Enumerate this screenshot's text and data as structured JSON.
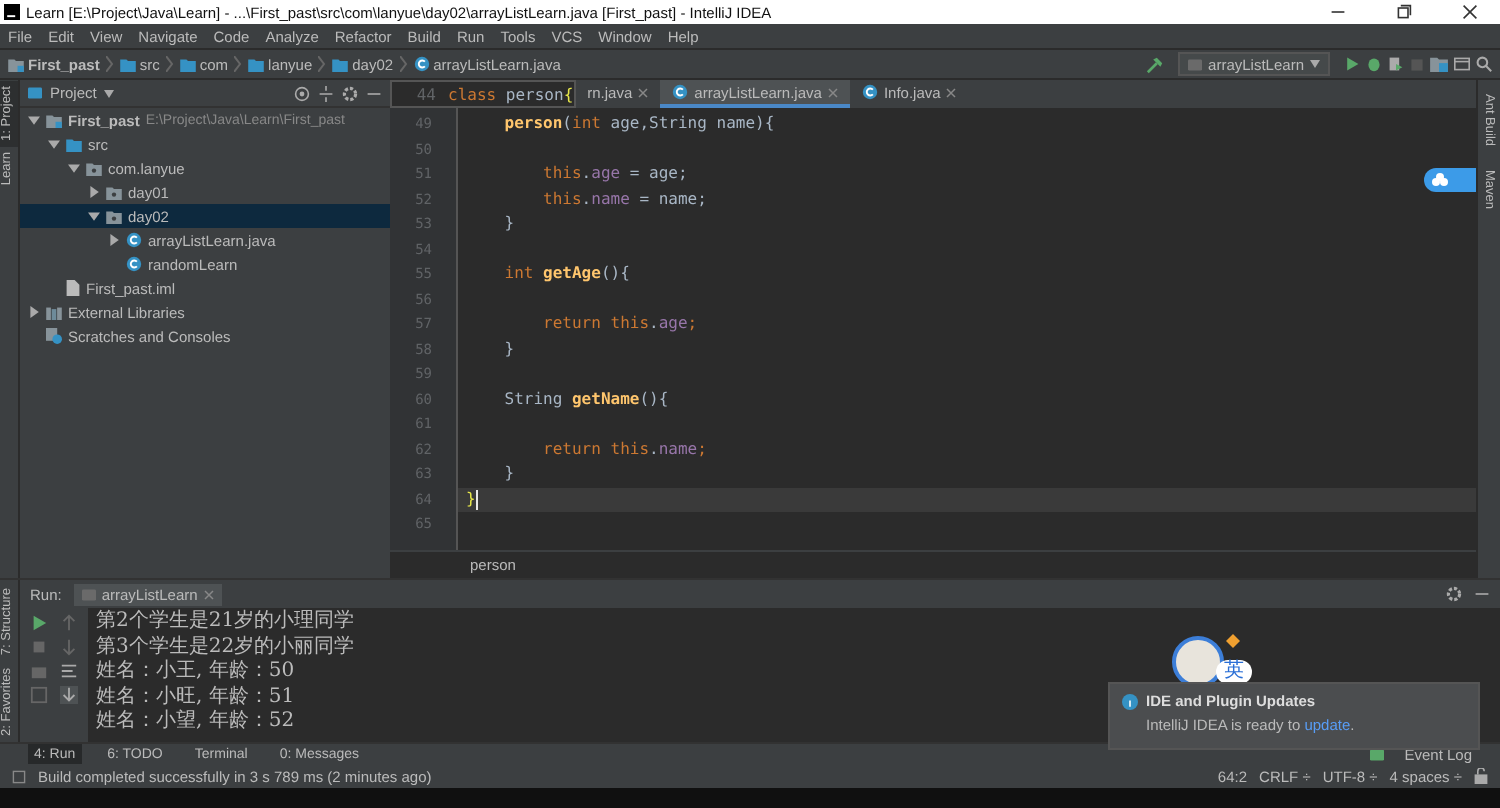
{
  "window": {
    "title": "Learn [E:\\Project\\Java\\Learn] - ...\\First_past\\src\\com\\lanyue\\day02\\arrayListLearn.java [First_past] - IntelliJ IDEA"
  },
  "menu": [
    "File",
    "Edit",
    "View",
    "Navigate",
    "Code",
    "Analyze",
    "Refactor",
    "Build",
    "Run",
    "Tools",
    "VCS",
    "Window",
    "Help"
  ],
  "breadcrumbs": [
    {
      "label": "First_past",
      "kind": "module"
    },
    {
      "label": "src",
      "kind": "folder"
    },
    {
      "label": "com",
      "kind": "folder"
    },
    {
      "label": "lanyue",
      "kind": "folder"
    },
    {
      "label": "day02",
      "kind": "folder"
    },
    {
      "label": "arrayListLearn.java",
      "kind": "class"
    }
  ],
  "run_config": "arrayListLearn",
  "left_stripe": [
    {
      "label": "1: Project",
      "selected": true
    },
    {
      "label": "Learn",
      "selected": false
    }
  ],
  "left_stripe_bottom": [
    "7: Structure",
    "2: Favorites"
  ],
  "project_panel": {
    "title": "Project",
    "tree": [
      {
        "label": "First_past",
        "path": "E:\\Project\\Java\\Learn\\First_past",
        "kind": "module",
        "expanded": true,
        "selected": false,
        "children": [
          {
            "label": "src",
            "kind": "folder",
            "expanded": true,
            "selected": false,
            "children": [
              {
                "label": "com.lanyue",
                "kind": "package",
                "expanded": true,
                "selected": false,
                "children": [
                  {
                    "label": "day01",
                    "kind": "package",
                    "expanded": false,
                    "selected": false
                  },
                  {
                    "label": "day02",
                    "kind": "package",
                    "expanded": true,
                    "selected": true,
                    "children": [
                      {
                        "label": "arrayListLearn.java",
                        "kind": "class",
                        "expanded": false,
                        "selected": false
                      },
                      {
                        "label": "randomLearn",
                        "kind": "class",
                        "selected": false
                      }
                    ]
                  }
                ]
              }
            ]
          },
          {
            "label": "First_past.iml",
            "kind": "file",
            "selected": false
          }
        ]
      },
      {
        "label": "External Libraries",
        "kind": "library",
        "expanded": false,
        "selected": false
      },
      {
        "label": "Scratches and Consoles",
        "kind": "scratch",
        "selected": false
      }
    ]
  },
  "editor": {
    "sticky": {
      "number": "44",
      "tokens": [
        {
          "t": "class",
          "kind": "keyword"
        },
        {
          "t": " person",
          "kind": "plain"
        },
        {
          "t": "{",
          "kind": "brace"
        }
      ]
    },
    "tabs": [
      {
        "label": "rn.java",
        "selected": false
      },
      {
        "label": "arrayListLearn.java",
        "selected": true
      },
      {
        "label": "Info.java",
        "selected": false
      }
    ],
    "lines": [
      {
        "number": "49",
        "current": false,
        "tokens": [
          {
            "t": "    person",
            "kind": "method"
          },
          {
            "t": "(",
            "kind": "plain"
          },
          {
            "t": "int",
            "kind": "keyword"
          },
          {
            "t": " age,String name){",
            "kind": "plain"
          }
        ]
      },
      {
        "number": "50",
        "current": false
      },
      {
        "number": "51",
        "current": false,
        "tokens": [
          {
            "t": "        this",
            "kind": "keyword"
          },
          {
            "t": ".",
            "kind": "plain"
          },
          {
            "t": "age",
            "kind": "field"
          },
          {
            "t": " = age;",
            "kind": "plain"
          }
        ]
      },
      {
        "number": "52",
        "current": false,
        "tokens": [
          {
            "t": "        this",
            "kind": "keyword"
          },
          {
            "t": ".",
            "kind": "plain"
          },
          {
            "t": "name",
            "kind": "field"
          },
          {
            "t": " = name;",
            "kind": "plain"
          }
        ]
      },
      {
        "number": "53",
        "current": false,
        "tokens": [
          {
            "t": "    }",
            "kind": "plain"
          }
        ]
      },
      {
        "number": "54",
        "current": false
      },
      {
        "number": "55",
        "current": false,
        "tokens": [
          {
            "t": "    int",
            "kind": "keyword"
          },
          {
            "t": " getAge",
            "kind": "method"
          },
          {
            "t": "(){",
            "kind": "plain"
          }
        ]
      },
      {
        "number": "56",
        "current": false
      },
      {
        "number": "57",
        "current": false,
        "tokens": [
          {
            "t": "        return this",
            "kind": "keyword"
          },
          {
            "t": ".",
            "kind": "plain"
          },
          {
            "t": "age",
            "kind": "field"
          },
          {
            "t": ";",
            "kind": "keyword"
          }
        ]
      },
      {
        "number": "58",
        "current": false,
        "tokens": [
          {
            "t": "    }",
            "kind": "plain"
          }
        ]
      },
      {
        "number": "59",
        "current": false
      },
      {
        "number": "60",
        "current": false,
        "tokens": [
          {
            "t": "    String",
            "kind": "plain"
          },
          {
            "t": " getName",
            "kind": "method"
          },
          {
            "t": "(){",
            "kind": "plain"
          }
        ]
      },
      {
        "number": "61",
        "current": false
      },
      {
        "number": "62",
        "current": false,
        "tokens": [
          {
            "t": "        return this",
            "kind": "keyword"
          },
          {
            "t": ".",
            "kind": "plain"
          },
          {
            "t": "name",
            "kind": "field"
          },
          {
            "t": ";",
            "kind": "keyword"
          }
        ]
      },
      {
        "number": "63",
        "current": false,
        "tokens": [
          {
            "t": "    }",
            "kind": "plain"
          }
        ]
      },
      {
        "number": "64",
        "current": true,
        "tokens": [
          {
            "t": "}",
            "kind": "brace"
          }
        ]
      },
      {
        "number": "65",
        "current": false
      }
    ],
    "breadcrumb": "person"
  },
  "right_stripe": [
    "Ant Build",
    "Maven"
  ],
  "run_panel": {
    "label": "Run:",
    "tab": "arrayListLearn",
    "output": [
      "第2个学生是21岁的小理同学",
      "第3个学生是22岁的小丽同学",
      "姓名：小王, 年龄：50",
      "姓名：小旺, 年龄：51",
      "姓名：小望, 年龄：52"
    ]
  },
  "notification": {
    "title": "IDE and Plugin Updates",
    "text": "IntelliJ IDEA is ready to ",
    "link": "update",
    "end": "."
  },
  "ime_badge": "英",
  "tool_tabs": [
    {
      "label": "4: Run",
      "selected": true
    },
    {
      "label": "6: TODO",
      "selected": false
    },
    {
      "label": "Terminal",
      "selected": false
    },
    {
      "label": "0: Messages",
      "selected": false
    }
  ],
  "event_log": "Event Log",
  "status": {
    "message": "Build completed successfully in 3 s 789 ms (2 minutes ago)",
    "items": [
      "64:2",
      "CRLF ÷",
      "UTF-8 ÷",
      "4 spaces ÷"
    ]
  }
}
